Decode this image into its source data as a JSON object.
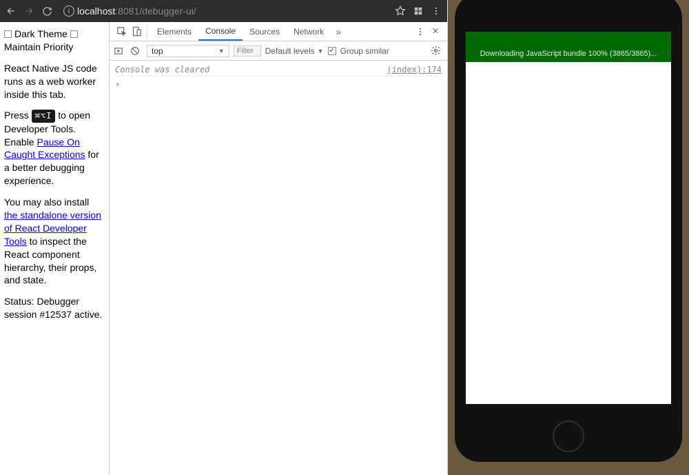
{
  "browser": {
    "url_host": "localhost",
    "url_port": ":8081",
    "url_path": "/debugger-ui/"
  },
  "page": {
    "dark_theme": "Dark Theme",
    "maintain_priority": "Maintain Priority",
    "para1": "React Native JS code runs as a web worker inside this tab.",
    "press": "Press ",
    "shortcut": "⌘⌥I",
    "to_open": " to open Developer Tools. Enable ",
    "pause_link": "Pause On Caught Exceptions",
    "for_better": " for a better debugging experience.",
    "you_may": "You may also install ",
    "standalone_link": "the standalone version of React Developer Tools",
    "to_inspect": " to inspect the React component hierarchy, their props, and state.",
    "status": "Status: Debugger session #12537 active."
  },
  "devtools": {
    "tabs": {
      "elements": "Elements",
      "console": "Console",
      "sources": "Sources",
      "network": "Network"
    },
    "toolbar": {
      "context": "top",
      "filter_placeholder": "Filter",
      "levels": "Default levels",
      "group": "Group similar"
    },
    "console": {
      "cleared": "Console was cleared",
      "src": "(index):174",
      "prompt": "›"
    }
  },
  "phone": {
    "banner": "Downloading JavaScript bundle 100% (3865/3865)..."
  }
}
